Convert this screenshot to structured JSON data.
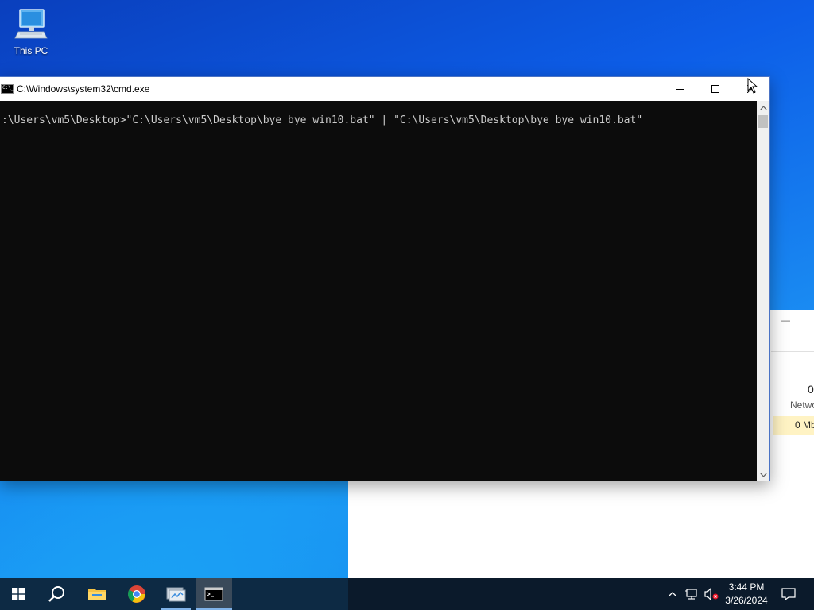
{
  "desktop": {
    "icons": [
      {
        "label": "This PC",
        "icon": "this-pc-icon"
      }
    ]
  },
  "cmd_window": {
    "title": "C:\\Windows\\system32\\cmd.exe",
    "console_lines": [
      ":\\Users\\vm5\\Desktop>\"C:\\Users\\vm5\\Desktop\\bye bye win10.bat\" | \"C:\\Users\\vm5\\Desktop\\bye bye win10.bat\""
    ],
    "buttons": {
      "minimize": "minimize-icon",
      "maximize": "maximize-icon",
      "close": "close-icon"
    }
  },
  "background_window": {
    "stat_value": "0",
    "stat_label": "Netwo",
    "stat_cell": "0 Mb"
  },
  "taskbar": {
    "items": [
      "windows-start-icon",
      "search-icon",
      "file-explorer-icon",
      "chrome-icon",
      "app-icon",
      "cmd-icon"
    ],
    "clock_time": "3:44 PM",
    "clock_date": "3/26/2024"
  },
  "colors": {
    "console_bg": "#0c0c0c",
    "console_text": "#cccccc",
    "taskbar_bg": "#0b1a2b",
    "desktop_accent": "#0d63e6"
  }
}
